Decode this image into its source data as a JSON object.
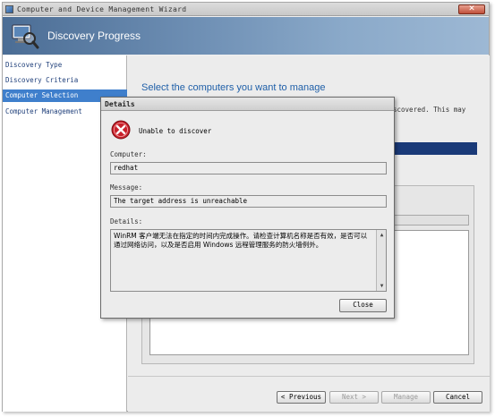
{
  "window": {
    "title": "Computer and Device Management Wizard",
    "close_symbol": "✕"
  },
  "banner": {
    "title": "Discovery Progress",
    "icon": "computer-magnifier-icon"
  },
  "nav": {
    "items": [
      {
        "label": "Discovery Type",
        "active": false
      },
      {
        "label": "Discovery Criteria",
        "active": false
      },
      {
        "label": "Computer Selection",
        "active": true
      },
      {
        "label": "Computer Management",
        "active": false
      }
    ]
  },
  "main": {
    "heading": "Select the computers you want to manage",
    "intro_tail": "scovered. This may"
  },
  "buttons": {
    "previous": "< Previous",
    "next": "Next >",
    "manage": "Manage",
    "cancel": "Cancel"
  },
  "dialog": {
    "title": "Details",
    "error_text": "Unable to discover",
    "computer_label": "Computer:",
    "computer_value": "redhat",
    "message_label": "Message:",
    "message_value": "The target address is unreachable",
    "details_label": "Details:",
    "details_value": "WinRM 客户端无法在指定的时间内完成操作。请检查计算机名称是否有效，是否可以通过网络访问，以及是否启用 Windows 远程管理服务的防火墙例外。",
    "close_label": "Close",
    "scroll_up": "▲",
    "scroll_down": "▼"
  },
  "colors": {
    "accent": "#3f7fcc",
    "heading": "#1f5fa8",
    "error": "#c8202a"
  }
}
